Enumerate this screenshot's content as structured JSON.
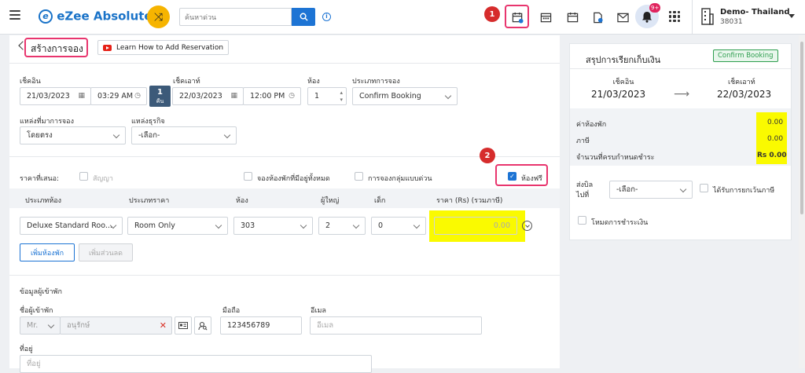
{
  "app": {
    "name": "eZee Absolute",
    "logo_letter": "e"
  },
  "search": {
    "placeholder": "ค้นหาด่วน"
  },
  "topbar": {
    "badge1": "1",
    "bell_count": "9+",
    "property_name": "Demo- Thailand",
    "property_id": "38031"
  },
  "page": {
    "title": "สร้างการจอง",
    "learn_link": "Learn How to Add Reservation"
  },
  "stay": {
    "checkin_label": "เช็คอิน",
    "checkin_date": "21/03/2023",
    "checkin_time": "03:29 AM",
    "nights": "1",
    "nights_unit": "คืน",
    "checkout_label": "เช็คเอาท์",
    "checkout_date": "22/03/2023",
    "checkout_time": "12:00 PM",
    "rooms_label": "ห้อง",
    "rooms_value": "1",
    "booking_type_label": "ประเภทการจอง",
    "booking_type_value": "Confirm Booking"
  },
  "source": {
    "source_label": "แหล่งที่มาการจอง",
    "source_value": "โดยตรง",
    "business_label": "แหล่งธุรกิจ",
    "business_value": "-เลือก-"
  },
  "rate_options": {
    "offer_label": "ราคาที่เสนอ:",
    "contract_label": "สัญญา",
    "all_available_label": "จองห้องพักที่มีอยู่ทั้งหมด",
    "quick_group_label": "การจองกลุ่มแบบด่วน",
    "free_room_label": "ห้องฟรี",
    "badge2": "2"
  },
  "room_table": {
    "headers": [
      "ประเภทห้อง",
      "ประเภทราคา",
      "ห้อง",
      "ผู้ใหญ่",
      "เด็ก",
      "ราคา (Rs)  (รวมภาษี)"
    ],
    "row": {
      "room_type": "Deluxe Standard Roo...",
      "rate_type": "Room Only",
      "room": "303",
      "adults": "2",
      "children": "0",
      "price": "0.00"
    },
    "add_room_button": "เพิ่มห้องพัก",
    "add_discount_button": "เพิ่มส่วนลด"
  },
  "guest": {
    "section_title": "ข้อมูลผู้เข้าพัก",
    "name_label": "ชื่อผู้เข้าพัก",
    "salutation": "Mr.",
    "name_placeholder": "อนุรักษ์",
    "mobile_label": "มือถือ",
    "mobile_value": "123456789",
    "email_label": "อีเมล",
    "email_placeholder": "อีเมล",
    "address_label": "ที่อยู่",
    "address_placeholder": "ที่อยู่"
  },
  "billing": {
    "title": "สรุปการเรียกเก็บเงิน",
    "status": "Confirm Booking",
    "checkin_label": "เช็คอิน",
    "checkin_date": "21/03/2023",
    "checkout_label": "เช็คเอาท์",
    "checkout_date": "22/03/2023",
    "arrow": "⟶",
    "room_charge_label": "ค่าห้องพัก",
    "room_charge": "0.00",
    "tax_label": "ภาษี",
    "tax": "0.00",
    "due_label": "จำนวนที่ครบกำหนดชำระ",
    "due": "Rs 0.00",
    "bill_to_label": "ส่งบิล ไปที่",
    "bill_to_value": "-เลือก-",
    "tax_exempt_label": "ได้รับการยกเว้นภาษี",
    "payment_mode_label": "โหมดการชำระเงิน"
  },
  "colors": {
    "accent": "#1d74d4",
    "highlight": "#fafa00",
    "callout": "#e8356e",
    "status_green": "#2e9e4f"
  }
}
